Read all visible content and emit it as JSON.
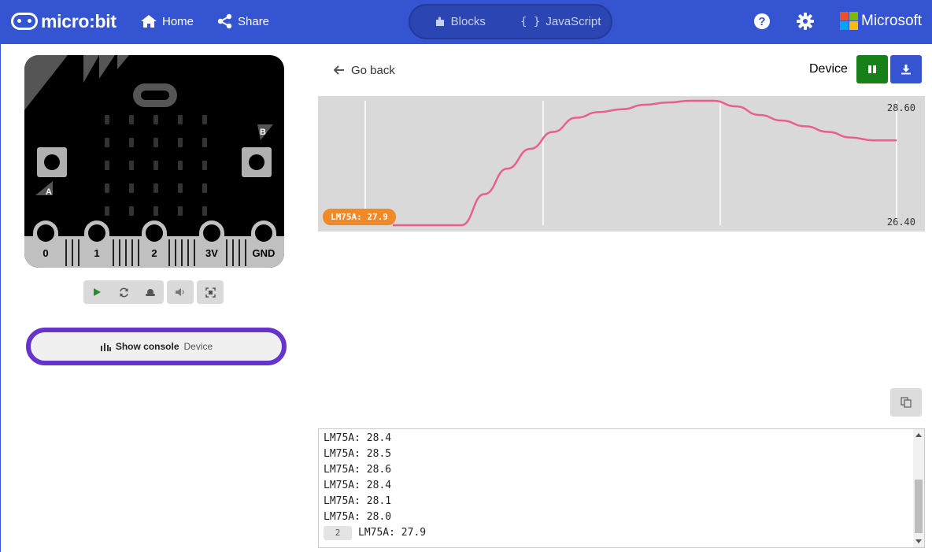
{
  "topbar": {
    "brand": "micro:bit",
    "home_label": "Home",
    "share_label": "Share",
    "editor_tabs": [
      {
        "label": "Blocks",
        "icon": "puzzle-icon"
      },
      {
        "label": "JavaScript",
        "icon": "{ }"
      }
    ],
    "microsoft_label": "Microsoft",
    "accent": "#3454D1"
  },
  "simulator": {
    "pin_labels": [
      "0",
      "1",
      "2",
      "3V",
      "GND"
    ],
    "button_a": "A",
    "button_b": "B",
    "console_button": {
      "label": "Show console",
      "sub": "Device"
    }
  },
  "serial": {
    "back_label": "Go back",
    "device_label": "Device",
    "chart": {
      "y_max_label": "28.60",
      "y_min_label": "26.40",
      "series_badge": "LM75A: 27.9",
      "line_color": "#E8608A"
    },
    "console_lines": [
      "LM75A: 28.4",
      "LM75A: 28.5",
      "LM75A: 28.6",
      "LM75A: 28.4",
      "LM75A: 28.1",
      "LM75A: 28.0"
    ],
    "last_line": {
      "count": "2",
      "text": "LM75A: 27.9"
    }
  },
  "chart_data": {
    "type": "line",
    "series": [
      {
        "name": "LM75A",
        "values": [
          26.4,
          26.4,
          26.4,
          26.4,
          26.95,
          27.4,
          27.75,
          28.05,
          28.3,
          28.4,
          28.45,
          28.53,
          28.57,
          28.6,
          28.6,
          28.5,
          28.35,
          28.25,
          28.15,
          28.05,
          27.95,
          27.9,
          27.9
        ]
      }
    ],
    "ylim": [
      26.4,
      28.6
    ],
    "grid": true
  }
}
